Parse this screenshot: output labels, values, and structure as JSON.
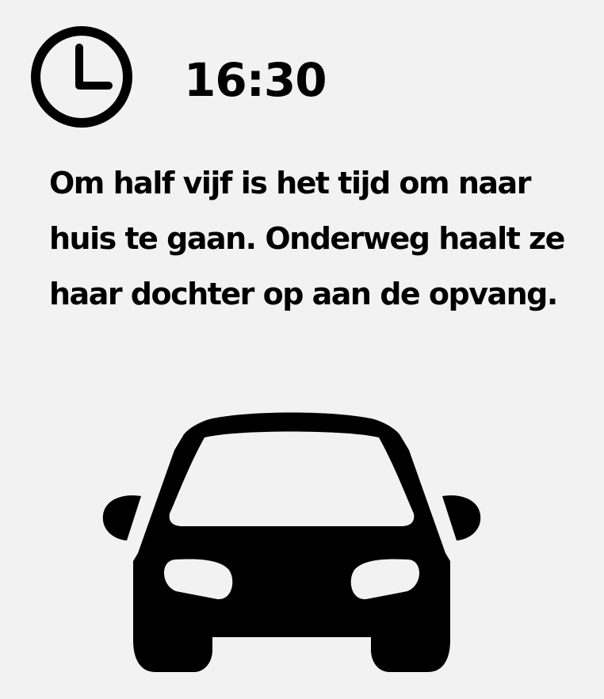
{
  "time": "16:30",
  "message": "Om half vijf is het tijd om naar huis te gaan. Onderweg haalt ze haar dochter op aan de opvang.",
  "icons": {
    "clock": "clock-icon",
    "car": "car-icon"
  },
  "colors": {
    "background": "#f2f2f2",
    "foreground": "#000000"
  }
}
